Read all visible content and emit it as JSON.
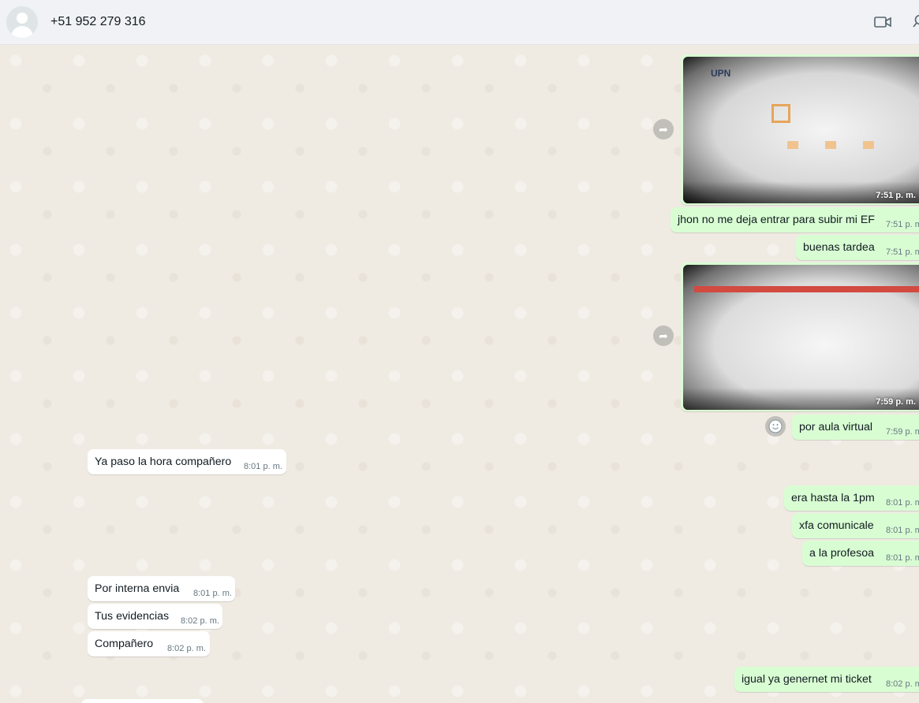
{
  "header": {
    "contact_name": "+51 952 279 316",
    "icons": [
      "avatar",
      "video-call-icon",
      "search-icon"
    ]
  },
  "colors": {
    "header_bg": "#f0f2f5",
    "chat_bg": "#efeae2",
    "outgoing_bubble": "#d9fdd3",
    "incoming_bubble": "#ffffff",
    "time_text": "#667781"
  },
  "messages": [
    {
      "direction": "out",
      "type": "image",
      "time": "7:51 p. m."
    },
    {
      "direction": "out",
      "type": "text",
      "text": "jhon no me deja entrar para subir mi EF",
      "time": "7:51 p. m."
    },
    {
      "direction": "out",
      "type": "text",
      "text": "buenas tardea",
      "time": "7:51 p. m."
    },
    {
      "direction": "out",
      "type": "image",
      "time": "7:59 p. m."
    },
    {
      "direction": "out",
      "type": "text",
      "text": "por aula virtual",
      "time": "7:59 p. m."
    },
    {
      "direction": "in",
      "type": "text",
      "text": "Ya paso la hora compañero",
      "time": "8:01 p. m."
    },
    {
      "direction": "out",
      "type": "text",
      "text": "era hasta la 1pm",
      "time": "8:01 p. m."
    },
    {
      "direction": "out",
      "type": "text",
      "text": "xfa comunicale",
      "time": "8:01 p. m."
    },
    {
      "direction": "out",
      "type": "text",
      "text": "a la profesoa",
      "time": "8:01 p. m."
    },
    {
      "direction": "in",
      "type": "text",
      "text": "Por interna envia",
      "time": "8:01 p. m."
    },
    {
      "direction": "in",
      "type": "text",
      "text": "Tus evidencias",
      "time": "8:02 p. m."
    },
    {
      "direction": "in",
      "type": "text",
      "text": "Compañero",
      "time": "8:02 p. m."
    },
    {
      "direction": "out",
      "type": "text",
      "text": "igual ya genernet mi ticket",
      "time": "8:02 p. m."
    }
  ],
  "photo1": {
    "logo_text": "UPN"
  }
}
